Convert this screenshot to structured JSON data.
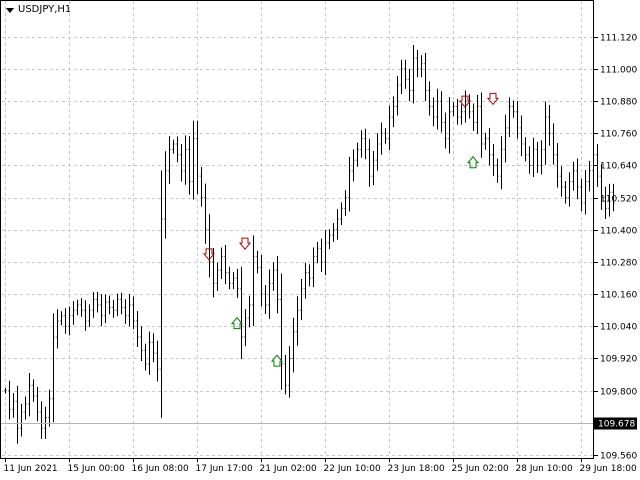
{
  "chart": {
    "symbol_caption": "USDJPY,H1",
    "current_price_label": "109.678",
    "current_price": 109.678
  },
  "colors": {
    "grid": "#c8c8c8",
    "bar": "#000000",
    "sell_arrow": "#b00000",
    "buy_arrow": "#008000",
    "price_badge": "#000000"
  },
  "icons": {
    "caption_dropdown": "triangle-down-icon",
    "sell_signal": "down-arrow-icon",
    "buy_signal": "up-arrow-icon"
  },
  "chart_data": {
    "type": "line",
    "title": "USDJPY,H1",
    "xlabel": "",
    "ylabel": "",
    "ylim": [
      109.56,
      111.16
    ],
    "grid": true,
    "y_ticks": [
      "111.120",
      "111.000",
      "110.880",
      "110.760",
      "110.640",
      "110.520",
      "110.400",
      "110.280",
      "110.160",
      "110.040",
      "109.920",
      "109.800",
      "109.678",
      "109.560"
    ],
    "x_ticks": [
      "11 Jun 2021",
      "15 Jun 00:00",
      "16 Jun 08:00",
      "17 Jun 17:00",
      "21 Jun 02:00",
      "22 Jun 10:00",
      "23 Jun 18:00",
      "25 Jun 02:00",
      "28 Jun 10:00",
      "29 Jun 18:00"
    ],
    "x_tick_bar_index": [
      0,
      16,
      32,
      48,
      64,
      80,
      96,
      112,
      128,
      144
    ],
    "series": [
      {
        "values": [
          109.8,
          109.73,
          109.76,
          109.66,
          109.72,
          109.75,
          109.82,
          109.78,
          109.72,
          109.66,
          109.7,
          109.77,
          110.0,
          110.06,
          110.08,
          110.04,
          110.08,
          110.1,
          110.12,
          110.1,
          110.06,
          110.1,
          110.14,
          110.12,
          110.08,
          110.13,
          110.11,
          110.1,
          110.14,
          110.11,
          110.08,
          110.12,
          110.06,
          110.0,
          109.95,
          109.9,
          109.98,
          109.94,
          109.88,
          110.44,
          110.62,
          110.7,
          110.72,
          110.68,
          110.62,
          110.7,
          110.58,
          110.74,
          110.6,
          110.52,
          110.4,
          110.28,
          110.2,
          110.25,
          110.3,
          110.24,
          110.2,
          110.22,
          110.18,
          110.0,
          110.07,
          110.12,
          110.3,
          110.26,
          110.16,
          110.12,
          110.2,
          110.25,
          110.14,
          109.9,
          109.82,
          109.92,
          110.02,
          110.1,
          110.18,
          110.24,
          110.22,
          110.3,
          110.33,
          110.28,
          110.35,
          110.38,
          110.4,
          110.44,
          110.48,
          110.52,
          110.62,
          110.66,
          110.7,
          110.74,
          110.7,
          110.6,
          110.66,
          110.72,
          110.76,
          110.74,
          110.82,
          110.86,
          110.94,
          111.0,
          110.96,
          110.92,
          111.04,
          111.0,
          111.02,
          110.92,
          110.86,
          110.82,
          110.88,
          110.8,
          110.74,
          110.84,
          110.86,
          110.82,
          110.84,
          110.88,
          110.84,
          110.8,
          110.86,
          110.72,
          110.74,
          110.68,
          110.64,
          110.6,
          110.7,
          110.78,
          110.86,
          110.84,
          110.78,
          110.72,
          110.68,
          110.64,
          110.7,
          110.64,
          110.7,
          110.82,
          110.76,
          110.68,
          110.6,
          110.56,
          110.52,
          110.58,
          110.62,
          110.56,
          110.5,
          110.58,
          110.62,
          110.68,
          110.6,
          110.52,
          110.48,
          110.54,
          110.5
        ]
      }
    ],
    "annotations": {
      "sell_signals": [
        {
          "bar": 51,
          "price": 110.31
        },
        {
          "bar": 60,
          "price": 110.35
        },
        {
          "bar": 115,
          "price": 110.88
        },
        {
          "bar": 122,
          "price": 110.89
        }
      ],
      "buy_signals": [
        {
          "bar": 58,
          "price": 110.05
        },
        {
          "bar": 68,
          "price": 109.91
        },
        {
          "bar": 117,
          "price": 110.65
        }
      ]
    }
  }
}
